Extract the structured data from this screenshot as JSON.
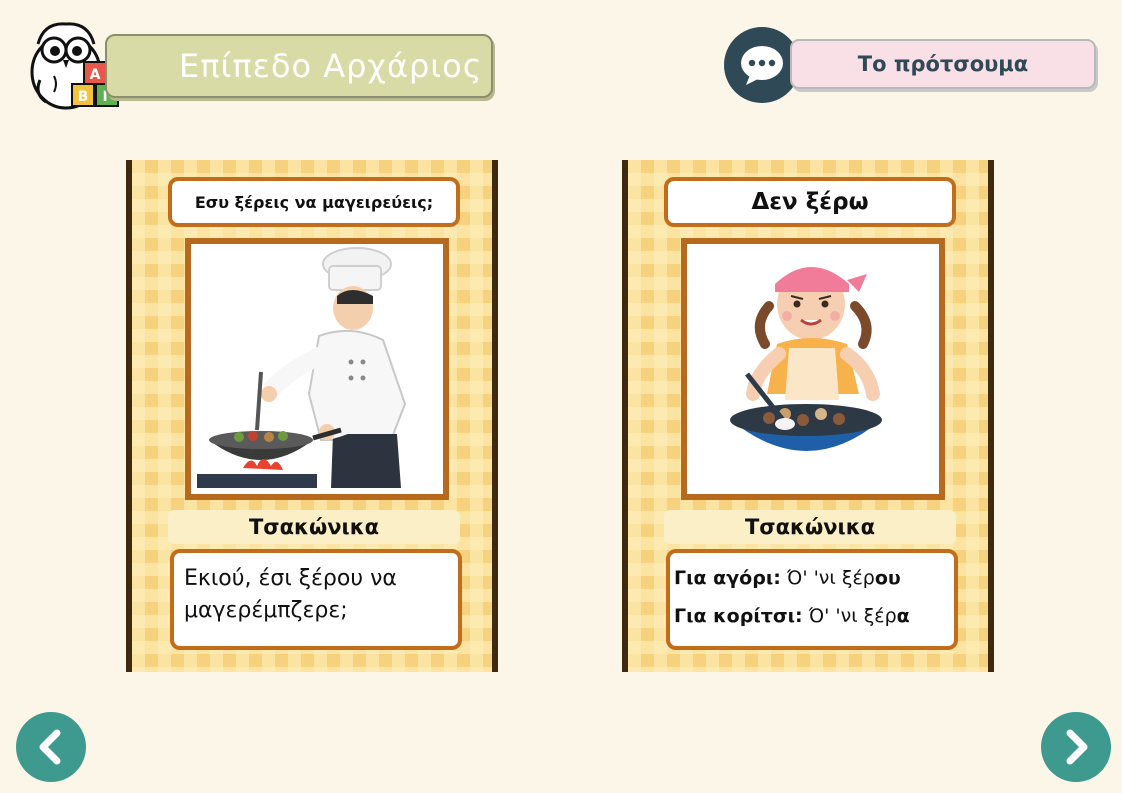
{
  "header": {
    "level_title": "Επίπεδο Αρχάριος",
    "summary_label": "Το πρότσουμα",
    "logo_letters": [
      "Α",
      "Β",
      "Γ"
    ],
    "chat_icon": "speech-bubble-icon"
  },
  "cards": [
    {
      "title": "Εσυ ξέρεις να μαγειρεύεις;",
      "image": "chef-cooking-illustration",
      "dialect": "Τσακώνικα",
      "text": "Εκιού, έσι ξέρου να μαγερέμπζερε;"
    },
    {
      "title": "Δεν ξέρω",
      "image": "girl-cooking-illustration",
      "dialect": "Τσακώνικα",
      "rows": [
        {
          "label": "Για αγόρι:",
          "text_plain": " Ό' 'νι ξέρ",
          "text_bold": "ου"
        },
        {
          "label": "Για κορίτσι:",
          "text_plain": " Ό' 'νι ξέρ",
          "text_bold": "α"
        }
      ]
    }
  ],
  "navigation": {
    "prev_icon": "chevron-left-icon",
    "next_icon": "chevron-right-icon"
  },
  "colors": {
    "background": "#fcf6e8",
    "accent_teal": "#3e9a8e",
    "dark_slate": "#2f4957",
    "card_border": "#c26d1b",
    "banner": "#d9dba6",
    "summary_pink": "#f9dfe6"
  }
}
